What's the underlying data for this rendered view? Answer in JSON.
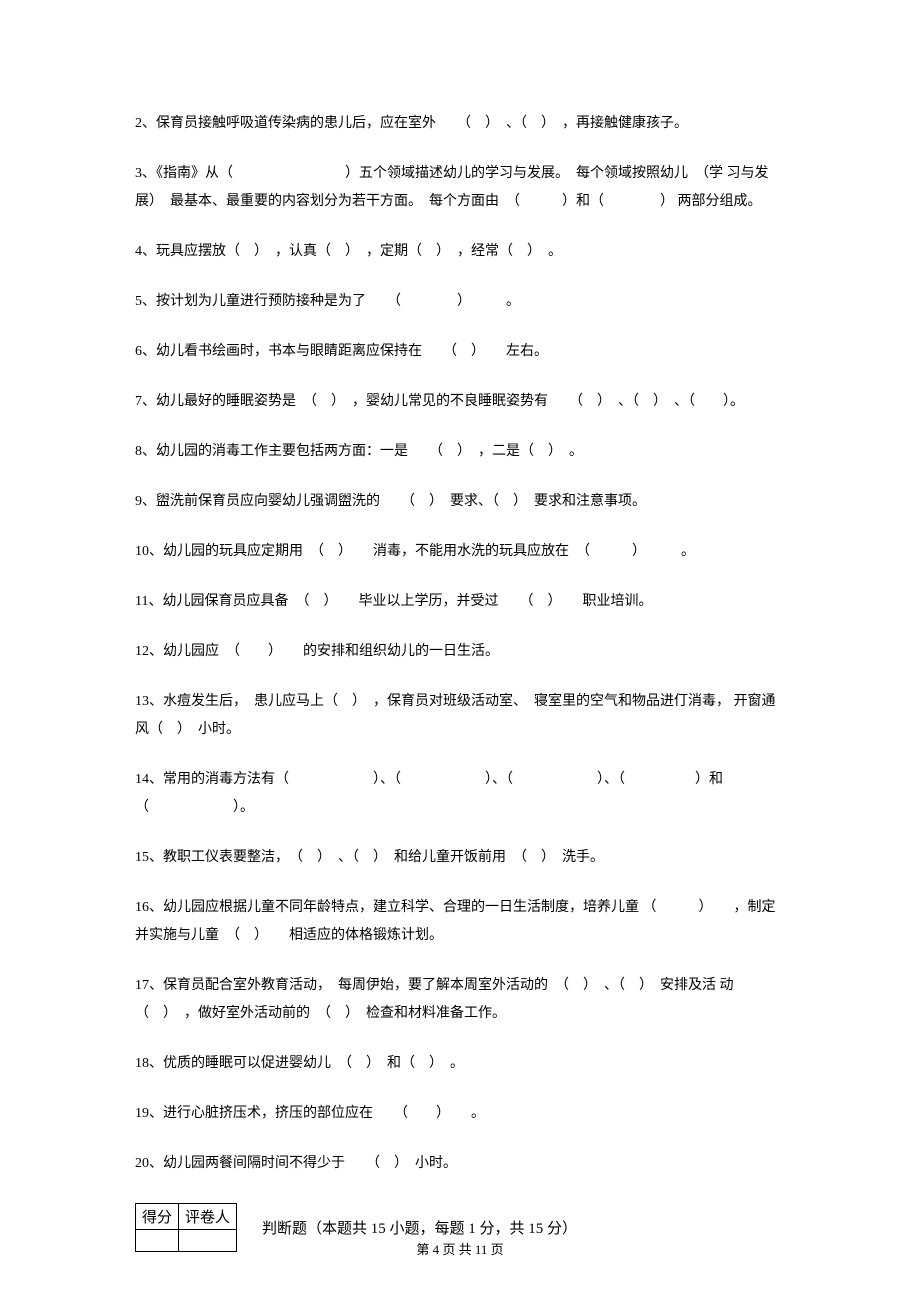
{
  "questions": {
    "q2": "2、保育员接触呼吸道传染病的患儿后，应在室外　　（　）　、（　）　，再接触健康孩子。",
    "q3_line1": "3、《指南》从（　　　　　　　　）五个领域描述幼儿的学习与发展。　每个领域按照幼儿　（学",
    "q3_line2": "习与发展）　最基本、最重要的内容划分为若干方面。　每个方面由　（　　　）和（　　　　）",
    "q3_line3": "两部分组成。",
    "q4": "4、玩具应摆放（　）　，认真（　）　，定期（　）　，经常（　）　。",
    "q5": "5、按计划为儿童进行预防接种是为了　　（　　　　）　　　。",
    "q6": "6、幼儿看书绘画时，书本与眼睛距离应保持在　　（　）　　左右。",
    "q7": "7、幼儿最好的睡眠姿势是　（　）　，婴幼儿常见的不良睡眠姿势有　　（　）　、（　）　、（　　）。",
    "q8": "8、幼儿园的消毒工作主要包括两方面：一是　　（　）　，二是（　）　。",
    "q9": "9、盥洗前保育员应向婴幼儿强调盥洗的　　（　）　要求、（　）　要求和注意事项。",
    "q10": "10、幼儿园的玩具应定期用　（　）　　消毒，不能用水洗的玩具应放在　（　　　）　　　。",
    "q11": "11、幼儿园保育员应具备　（　）　　毕业以上学历，并受过　　（　）　　职业培训。",
    "q12": "12、幼儿园应　（　　）　　的安排和组织幼儿的一日生活。",
    "q13_line1": "13、水痘发生后，　患儿应马上（　）　，保育员对班级活动室、　寝室里的空气和物品进仃消毒，",
    "q13_line2": "开窗通风（　）　小时。",
    "q14_line1": "14、常用的消毒方法有（　　　　　　）、（　　　　　　）、（　　　　　　）、（　　　　　）和",
    "q14_line2": "（　　　　　　）。",
    "q15": "15、教职工仪表要整洁，　（　）　、（　）　和给儿童开饭前用　（　）　洗手。",
    "q16_line1": "16、幼儿园应根据儿童不同年龄特点，建立科学、合理的一日生活制度，培养儿童",
    "q16_line2": "（　　　）　　，制定并实施与儿童　（　）　　相适应的体格锻炼计划。",
    "q17_line1": "17、保育员配合室外教育活动，　每周伊始，要了解本周室外活动的　（　）　、（　）　安排及活",
    "q17_line2": "动（　）　，做好室外活动前的　（　）　检查和材料准备工作。",
    "q18": "18、优质的睡眠可以促进婴幼儿　（　）　和（　）　。",
    "q19": "19、进行心脏挤压术，挤压的部位应在　　（　　）　　。",
    "q20": "20、幼儿园两餐间隔时间不得少于　　（　）　小时。"
  },
  "scoreTable": {
    "col1": "得分",
    "col2": "评卷人"
  },
  "sectionTitle": "判断题（本题共  15 小题，每题  1 分，共  15 分）",
  "footer": "第  4  页  共  11  页"
}
